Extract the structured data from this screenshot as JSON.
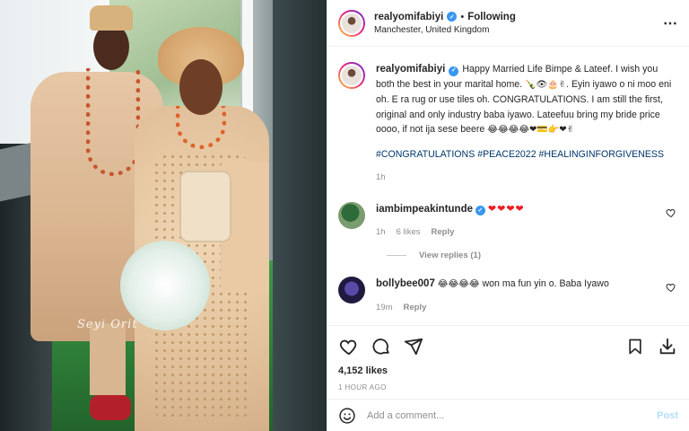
{
  "header": {
    "username": "realyomifabiyi",
    "follow_status": "Following",
    "location": "Manchester, United Kingdom"
  },
  "photo": {
    "watermark": "Seyi Orit"
  },
  "caption": {
    "username": "realyomifabiyi",
    "text_a": "Happy Married Life Bimpe & Lateef. I wish you both the best in your marital home.",
    "emojis_a": "🍾👁🎂✌",
    "text_b": ". Eyin iyawo o ni moo eni oh. E ra rug or use tiles oh. CONGRATULATIONS. I am still the first, original and only industry baba iyawo. Lateefuu bring my bride price oooo, if not ija sese beere",
    "emojis_b": "😂😂😂😂❤💳👉❤✌",
    "hashtags": "#CONGRATULATIONS #PEACE2022 #HEALINGINFORGIVENESS",
    "age": "1h"
  },
  "comments": [
    {
      "username": "iambimpeakintunde",
      "text": "❤❤❤❤",
      "age": "1h",
      "likes": "6 likes",
      "reply": "Reply",
      "view_replies": "View replies (1)"
    },
    {
      "username": "bollybee007",
      "emojis": "😂😂😂😂",
      "text": "won ma fun yin o. Baba Iyawo",
      "age": "19m",
      "reply": "Reply"
    }
  ],
  "stats": {
    "likes": "4,152 likes",
    "time_ago": "1 HOUR AGO"
  },
  "composer": {
    "placeholder": "Add a comment...",
    "post_label": "Post"
  },
  "colors": {
    "link": "#00376b",
    "verified": "#3897f0",
    "muted": "#8e8e8e",
    "post_disabled": "#b2dffc"
  }
}
